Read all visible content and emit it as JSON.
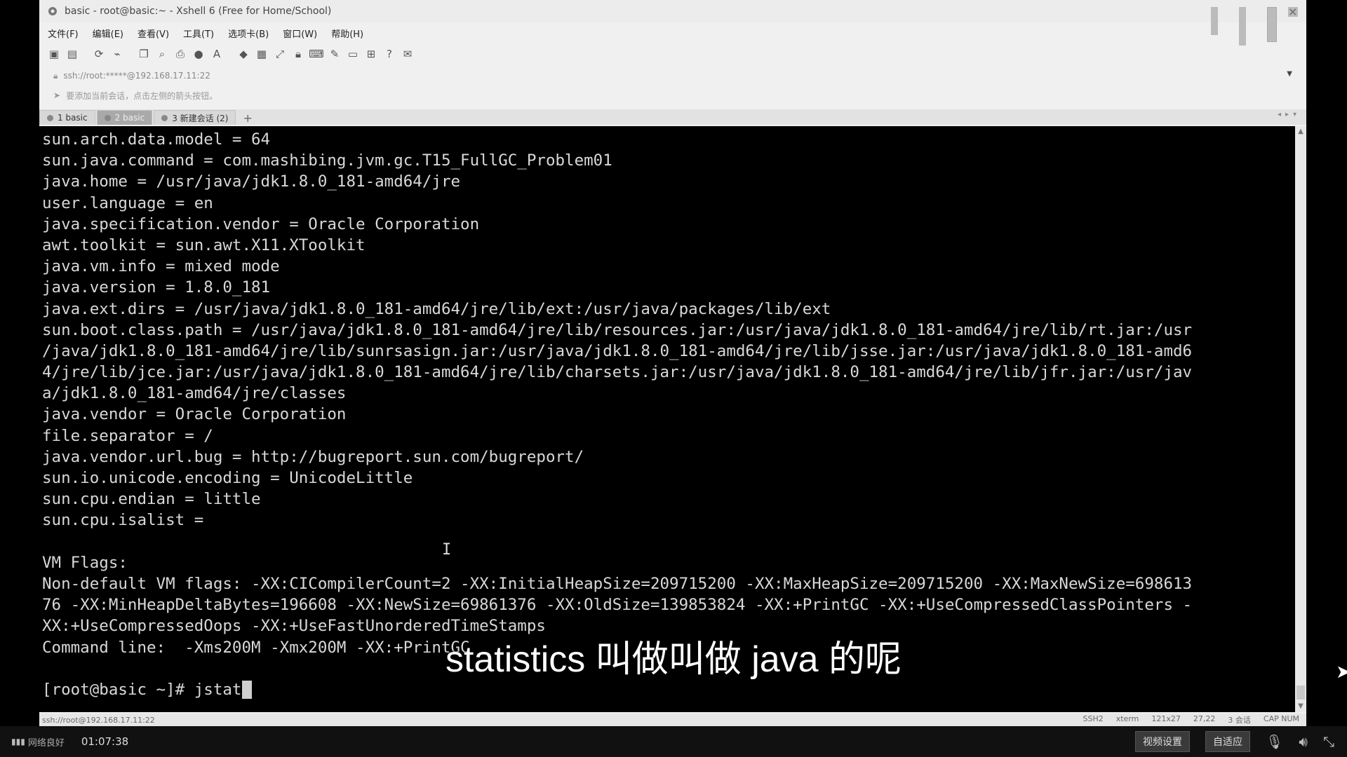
{
  "window": {
    "title": "basic - root@basic:~ - Xshell 6 (Free for Home/School)",
    "close_glyph": "×"
  },
  "menu": [
    "文件(F)",
    "编辑(E)",
    "查看(V)",
    "工具(T)",
    "选项卡(B)",
    "窗口(W)",
    "帮助(H)"
  ],
  "toolbar_icons": [
    "new-session-icon",
    "open-icon",
    "reconnect-icon",
    "disconnect-icon",
    "copy-icon",
    "find-icon",
    "print-icon",
    "globe-icon",
    "font-icon",
    "transfer-icon",
    "screenshot-icon",
    "fullscreen-icon",
    "lock-icon",
    "keyboard-icon",
    "script-icon",
    "layout-icon",
    "tile-icon",
    "help-icon",
    "chat-icon"
  ],
  "address": {
    "value": "ssh://root:*****@192.168.17.11:22"
  },
  "hint": {
    "text": "要添加当前会话，点击左侧的箭头按钮。"
  },
  "tabs": [
    {
      "label": "1 basic",
      "active": false
    },
    {
      "label": "2 basic",
      "active": true
    },
    {
      "label": "3 新建会话 (2)",
      "active": false
    }
  ],
  "tab_add": "+",
  "terminal": {
    "lines": [
      "sun.arch.data.model = 64",
      "sun.java.command = com.mashibing.jvm.gc.T15_FullGC_Problem01",
      "java.home = /usr/java/jdk1.8.0_181-amd64/jre",
      "user.language = en",
      "java.specification.vendor = Oracle Corporation",
      "awt.toolkit = sun.awt.X11.XToolkit",
      "java.vm.info = mixed mode",
      "java.version = 1.8.0_181",
      "java.ext.dirs = /usr/java/jdk1.8.0_181-amd64/jre/lib/ext:/usr/java/packages/lib/ext",
      "sun.boot.class.path = /usr/java/jdk1.8.0_181-amd64/jre/lib/resources.jar:/usr/java/jdk1.8.0_181-amd64/jre/lib/rt.jar:/usr",
      "/java/jdk1.8.0_181-amd64/jre/lib/sunrsasign.jar:/usr/java/jdk1.8.0_181-amd64/jre/lib/jsse.jar:/usr/java/jdk1.8.0_181-amd6",
      "4/jre/lib/jce.jar:/usr/java/jdk1.8.0_181-amd64/jre/lib/charsets.jar:/usr/java/jdk1.8.0_181-amd64/jre/lib/jfr.jar:/usr/jav",
      "a/jdk1.8.0_181-amd64/jre/classes",
      "java.vendor = Oracle Corporation",
      "file.separator = /",
      "java.vendor.url.bug = http://bugreport.sun.com/bugreport/",
      "sun.io.unicode.encoding = UnicodeLittle",
      "sun.cpu.endian = little",
      "sun.cpu.isalist = ",
      "",
      "VM Flags:",
      "Non-default VM flags: -XX:CICompilerCount=2 -XX:InitialHeapSize=209715200 -XX:MaxHeapSize=209715200 -XX:MaxNewSize=698613",
      "76 -XX:MinHeapDeltaBytes=196608 -XX:NewSize=69861376 -XX:OldSize=139853824 -XX:+PrintGC -XX:+UseCompressedClassPointers -",
      "XX:+UseCompressedOops -XX:+UseFastUnorderedTimeStamps",
      "Command line:  -Xms200M -Xmx200M -XX:+PrintGC",
      ""
    ],
    "prompt": "[root@basic ~]# ",
    "input": "jstat"
  },
  "subtitle": "statistics 叫做叫做 java 的呢",
  "statusbar": {
    "left": "ssh://root@192.168.17.11:22",
    "items": [
      "SSH2",
      "xterm",
      "121x27",
      "27,22",
      "3 会话",
      "CAP NUM"
    ]
  },
  "player": {
    "network": "网络良好",
    "time": "01:07:38",
    "btn_settings": "视频设置",
    "btn_fit": "自适应"
  },
  "colors": {
    "terminal_bg": "#000000",
    "terminal_fg": "#d8d8d8",
    "active_tab": "#a9a9a9"
  }
}
